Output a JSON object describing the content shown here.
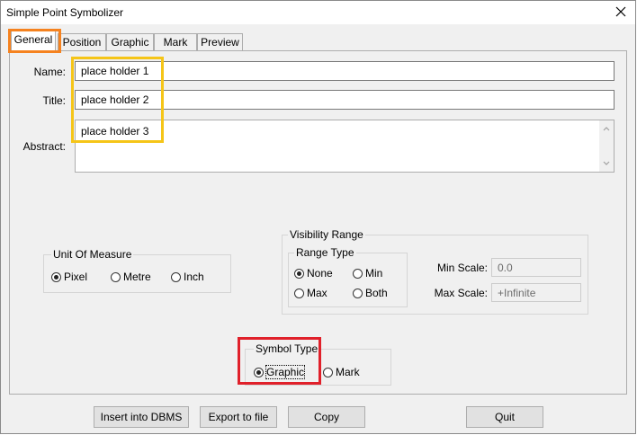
{
  "window": {
    "title": "Simple Point Symbolizer"
  },
  "tabs": [
    {
      "label": "General",
      "active": true
    },
    {
      "label": "Position",
      "active": false
    },
    {
      "label": "Graphic",
      "active": false
    },
    {
      "label": "Mark",
      "active": false
    },
    {
      "label": "Preview",
      "active": false
    }
  ],
  "general": {
    "name_label": "Name:",
    "name_value": "place holder 1",
    "title_label": "Title:",
    "title_value": "place holder 2",
    "abstract_label": "Abstract:",
    "abstract_value": "place holder 3"
  },
  "unit_of_measure": {
    "title": "Unit Of Measure",
    "options": [
      {
        "label": "Pixel",
        "checked": true
      },
      {
        "label": "Metre",
        "checked": false
      },
      {
        "label": "Inch",
        "checked": false
      }
    ]
  },
  "visibility_range": {
    "title": "Visibility Range",
    "range_type": {
      "title": "Range Type",
      "options": [
        {
          "label": "None",
          "checked": true
        },
        {
          "label": "Min",
          "checked": false
        },
        {
          "label": "Max",
          "checked": false
        },
        {
          "label": "Both",
          "checked": false
        }
      ]
    },
    "min_scale_label": "Min Scale:",
    "min_scale_value": "0.0",
    "max_scale_label": "Max Scale:",
    "max_scale_value": "+Infinite"
  },
  "symbol_type": {
    "title": "Symbol Type",
    "options": [
      {
        "label": "Graphic",
        "checked": true
      },
      {
        "label": "Mark",
        "checked": false
      }
    ]
  },
  "buttons": {
    "insert": "Insert into DBMS",
    "export": "Export to file",
    "copy": "Copy",
    "quit": "Quit"
  },
  "colors": {
    "highlight_orange": "#f5821f",
    "highlight_yellow": "#f5c518",
    "highlight_red": "#e0202a"
  },
  "icons": {
    "close": "close-icon",
    "scroll_up": "chevron-up-icon",
    "scroll_down": "chevron-down-icon"
  }
}
